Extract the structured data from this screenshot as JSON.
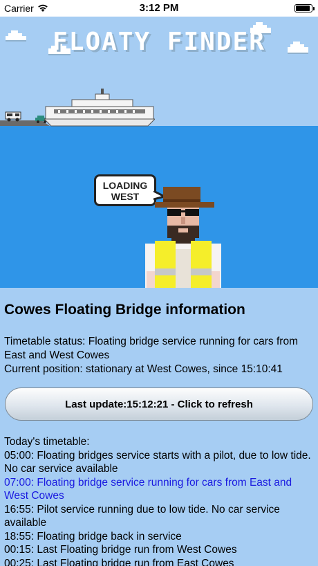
{
  "status_bar": {
    "carrier": "Carrier",
    "time": "3:12 PM"
  },
  "hero": {
    "title": "FLOATY FINDER",
    "speech_line1": "LOADING",
    "speech_line2": "WEST"
  },
  "info": {
    "heading": "Cowes Floating Bridge information",
    "timetable_status": "Timetable status: Floating bridge service running for cars from East and West Cowes",
    "current_position": "Current position: stationary at West Cowes, since 15:10:41"
  },
  "refresh_button": {
    "label": "Last update:15:12:21 - Click to refresh"
  },
  "timetable": {
    "title": "Today's timetable:",
    "rows": [
      {
        "text": "05:00: Floating bridges service starts with a pilot, due to low tide. No car service available"
      },
      {
        "text": "07:00: Floating bridge service running for cars from East and West Cowes"
      },
      {
        "text": "16:55: Pilot service running due to low tide. No car service available"
      },
      {
        "text": "18:55: Floating bridge back in service"
      },
      {
        "text": "00:15:  Last Floating bridge run from West Cowes"
      },
      {
        "text": "00:25:  Last Floating bridge run from East Cowes"
      }
    ]
  },
  "colors": {
    "sky": "#a6cdf3",
    "sea": "#2f95e8",
    "active_row": "#1a1ae0",
    "vest": "#f5ee2a"
  }
}
